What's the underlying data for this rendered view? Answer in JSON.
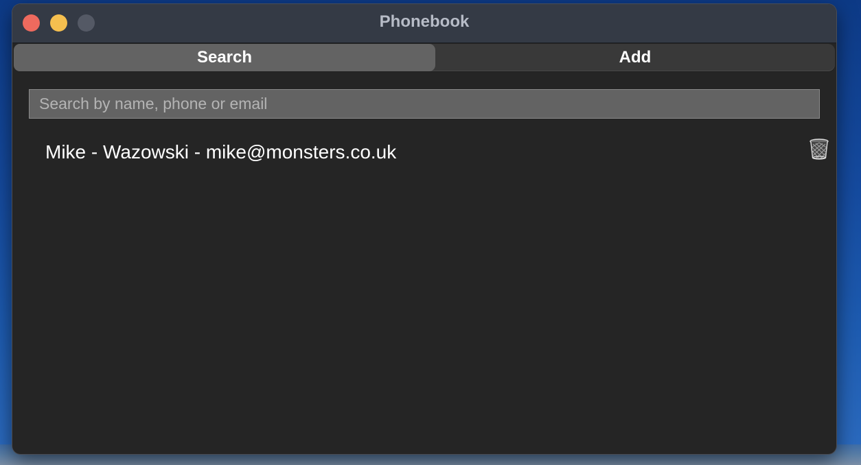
{
  "window": {
    "title": "Phonebook"
  },
  "tabs": [
    {
      "label": "Search",
      "selected": true
    },
    {
      "label": "Add",
      "selected": false
    }
  ],
  "search": {
    "placeholder": "Search by name, phone or email",
    "value": ""
  },
  "contacts": [
    {
      "display": "Mike - Wazowski - mike@monsters.co.uk",
      "delete_icon": "trash-icon"
    }
  ],
  "colors": {
    "window_background": "#252525",
    "titlebar": "#343a45",
    "selected_tab": "#636363",
    "close_button": "#ee6a5e",
    "minimize_button": "#f5bf4f",
    "zoom_button": "#545965"
  }
}
